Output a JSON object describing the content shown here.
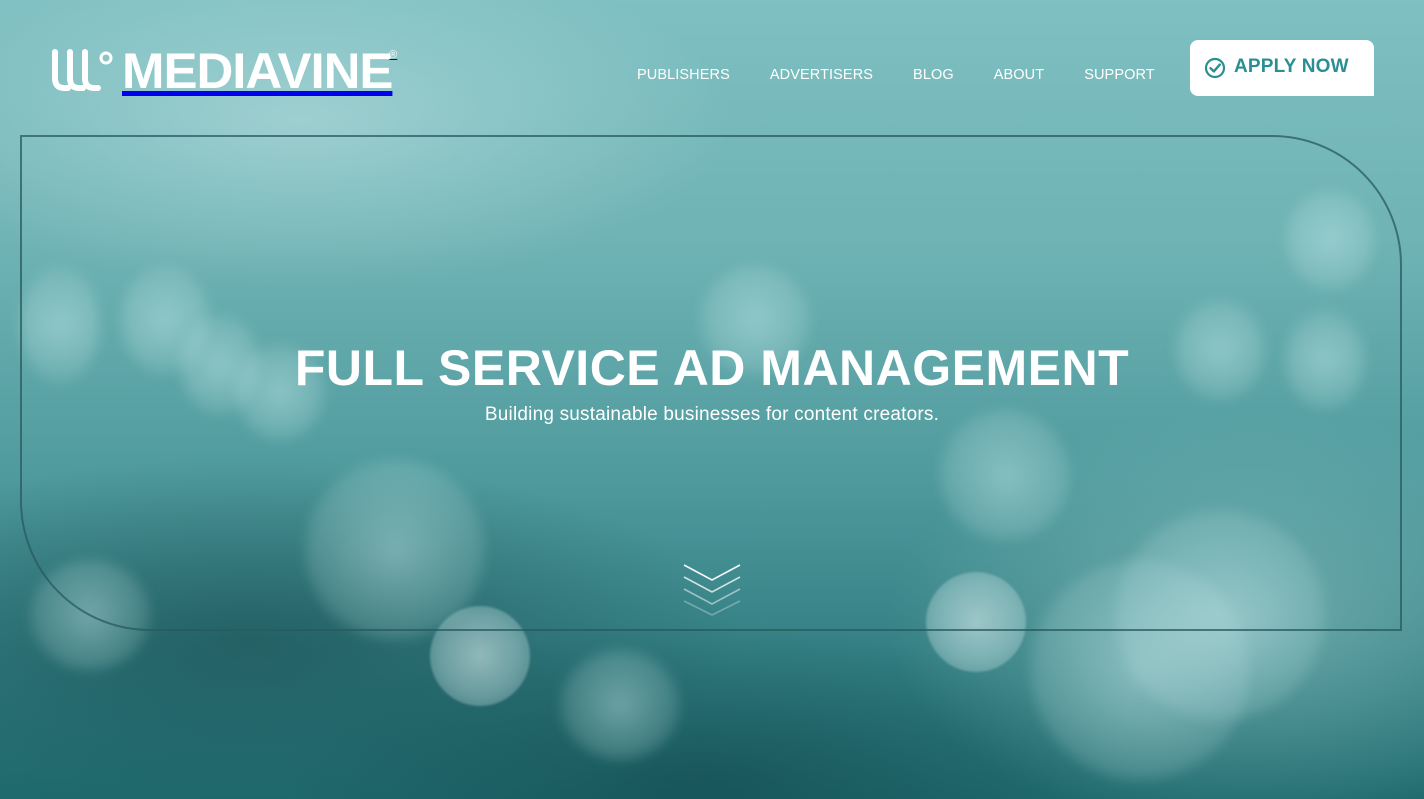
{
  "brand": {
    "name": "MEDIAVINE",
    "registered_mark": "®"
  },
  "nav": {
    "items": [
      {
        "label": "PUBLISHERS"
      },
      {
        "label": "ADVERTISERS"
      },
      {
        "label": "BLOG"
      },
      {
        "label": "ABOUT"
      },
      {
        "label": "SUPPORT"
      }
    ],
    "cta": {
      "label": "APPLY NOW",
      "icon": "check-circle-icon"
    }
  },
  "hero": {
    "title": "FULL SERVICE AD MANAGEMENT",
    "subtitle": "Building sustainable businesses for content creators.",
    "scroll_icon": "chevron-down-double-icon"
  },
  "colors": {
    "accent": "#2a8f92",
    "frame": "#285a5f",
    "text": "#ffffff"
  }
}
